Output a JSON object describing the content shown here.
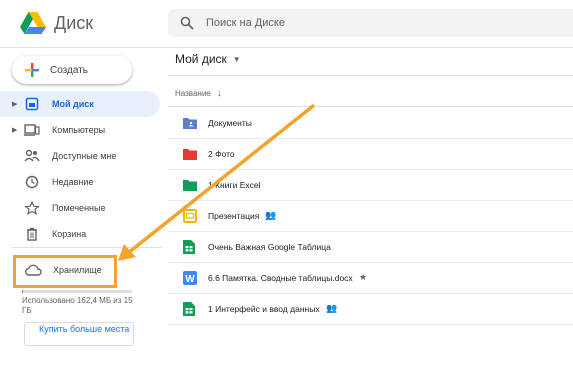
{
  "app": {
    "title": "Диск"
  },
  "search": {
    "placeholder": "Поиск на Диске"
  },
  "create_button": {
    "label": "Создать"
  },
  "sidebar": {
    "items": [
      {
        "label": "Мой диск",
        "icon": "drive-folder-icon"
      },
      {
        "label": "Компьютеры",
        "icon": "computers-icon"
      },
      {
        "label": "Доступные мне",
        "icon": "shared-people-icon"
      },
      {
        "label": "Недавние",
        "icon": "clock-icon"
      },
      {
        "label": "Помеченные",
        "icon": "star-icon"
      },
      {
        "label": "Корзина",
        "icon": "trash-icon"
      }
    ],
    "storage": {
      "label": "Хранилище",
      "usage_text": "Использовано 162,4 МБ из 15 ГБ",
      "usage_fraction": 0.011,
      "buy_label": "Купить больше места"
    }
  },
  "main": {
    "title": "Мой диск",
    "column_header": "Название",
    "files": [
      {
        "name": "Документы",
        "type": "folder",
        "color": "#5c7ec9"
      },
      {
        "name": "2 Фото",
        "type": "folder",
        "color": "#e53935"
      },
      {
        "name": "1 Книги Excel",
        "type": "folder",
        "color": "#0f9d58"
      },
      {
        "name": "Презентация",
        "type": "slides",
        "color": "#f4b400",
        "shared": true
      },
      {
        "name": "Очень Важная Google Таблица",
        "type": "sheets",
        "color": "#0f9d58"
      },
      {
        "name": "6.6 Памятка. Сводные таблицы.docx",
        "type": "docx",
        "color": "#4285f4",
        "starred": true
      },
      {
        "name": "1 Интерфейс и ввод данных",
        "type": "sheets",
        "color": "#0f9d58",
        "shared": true
      }
    ]
  },
  "colors": {
    "accent": "#1a73e8",
    "highlight": "#f2a42c",
    "active_bg": "#e8f0fe"
  }
}
